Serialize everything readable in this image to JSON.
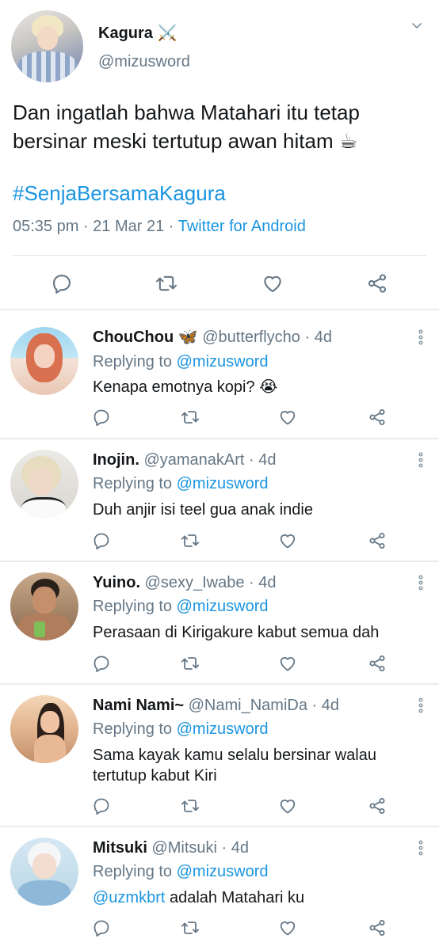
{
  "main_tweet": {
    "author_name": "Kagura",
    "author_emoji": "⚔️",
    "author_handle": "@mizusword",
    "text": "Dan ingatlah bahwa Matahari itu tetap bersinar meski tertutup awan hitam ☕",
    "hashtag": "#SenjaBersamaKagura",
    "time": "05:35 pm",
    "date": "21 Mar 21",
    "source": "Twitter for Android",
    "separator": " · "
  },
  "replies": [
    {
      "name": "ChouChou",
      "name_emoji": "🦋",
      "handle": "@butterflycho",
      "age": "4d",
      "replying_prefix": "Replying to",
      "replying_to": "@mizusword",
      "mention": "",
      "text": "Kenapa emotnya kopi? 😭"
    },
    {
      "name": "Inojin.",
      "name_emoji": "",
      "handle": "@yamanakArt",
      "age": "4d",
      "replying_prefix": "Replying to",
      "replying_to": "@mizusword",
      "mention": "",
      "text": "Duh anjir isi teel gua anak indie"
    },
    {
      "name": "Yuino.",
      "name_emoji": "",
      "handle": "@sexy_Iwabe",
      "age": "4d",
      "replying_prefix": "Replying to",
      "replying_to": "@mizusword",
      "mention": "",
      "text": "Perasaan di Kirigakure kabut semua dah"
    },
    {
      "name": "Nami Nami~",
      "name_emoji": "",
      "handle": "@Nami_NamiDa",
      "age": "4d",
      "replying_prefix": "Replying to",
      "replying_to": "@mizusword",
      "mention": "",
      "text": "Sama kayak kamu selalu bersinar walau tertutup kabut Kiri"
    },
    {
      "name": "Mitsuki",
      "name_emoji": "",
      "handle": "@Mitsuki",
      "age": "4d",
      "replying_prefix": "Replying to",
      "replying_to": "@mizusword",
      "mention": "@uzmkbrt",
      "text": " adalah Matahari ku"
    }
  ],
  "colors": {
    "link": "#1b95e0",
    "secondary_text": "#657786",
    "icon": "#657786",
    "divider": "#e6ecf0"
  },
  "icons": [
    "chevron-down-icon",
    "reply-icon",
    "retweet-icon",
    "like-icon",
    "share-icon",
    "more-vertical-icon"
  ]
}
